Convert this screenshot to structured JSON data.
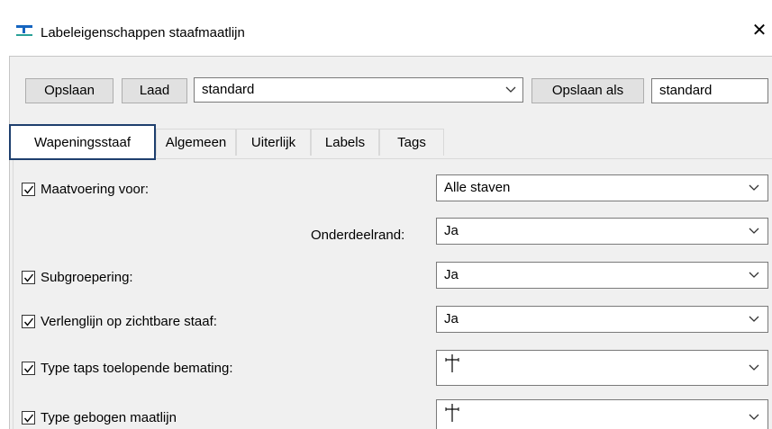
{
  "window": {
    "title": "Labeleigenschappen staafmaatlijn",
    "close_label": "✕"
  },
  "toolbar": {
    "save_label": "Opslaan",
    "load_label": "Laad",
    "preset_value": "standard",
    "save_as_label": "Opslaan als",
    "save_as_value": "standard"
  },
  "tabs": [
    {
      "label": "Wapeningsstaaf",
      "active": true
    },
    {
      "label": "Algemeen"
    },
    {
      "label": "Uiterlijk"
    },
    {
      "label": "Labels"
    },
    {
      "label": "Tags"
    }
  ],
  "rows": [
    {
      "label": "Maatvoering voor:",
      "checked": true,
      "value": "Alle staven"
    },
    {
      "label": "Onderdeelrand:",
      "checked": null,
      "value": "Ja"
    },
    {
      "label": "Subgroepering:",
      "checked": true,
      "value": "Ja"
    },
    {
      "label": "Verlenglijn op zichtbare staaf:",
      "checked": true,
      "value": "Ja"
    },
    {
      "label": "Type taps toelopende bemating:",
      "checked": true,
      "value": "dimension-symbol-icon"
    },
    {
      "label": "Type gebogen maatlijn",
      "checked": true,
      "value": "dimension-symbol-icon"
    }
  ],
  "colors": {
    "active_tab_border": "#1e3f6e",
    "icon_blue": "#1565c0",
    "icon_teal": "#2aa198"
  }
}
